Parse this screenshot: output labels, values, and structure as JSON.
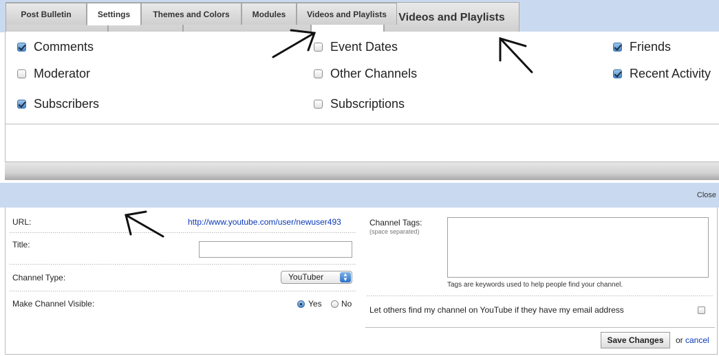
{
  "top_panel": {
    "tabs": [
      "Post Bulletin",
      "Settings",
      "Themes and Colors",
      "Modules",
      "Videos and Playlists"
    ],
    "active_tab": "Modules",
    "modules": [
      {
        "label": "Comments",
        "checked": true
      },
      {
        "label": "Moderator",
        "checked": false
      },
      {
        "label": "Subscribers",
        "checked": true
      },
      {
        "label": "Event Dates",
        "checked": false
      },
      {
        "label": "Other Channels",
        "checked": false
      },
      {
        "label": "Subscriptions",
        "checked": false
      },
      {
        "label": "Friends",
        "checked": true
      },
      {
        "label": "Recent Activity",
        "checked": true
      }
    ]
  },
  "bottom_panel": {
    "tabs": [
      "Post Bulletin",
      "Settings",
      "Themes and Colors",
      "Modules",
      "Videos and Playlists"
    ],
    "active_tab": "Settings",
    "close_label": "Close",
    "url_label": "URL:",
    "url_value": "http://www.youtube.com/user/newuser493",
    "title_label": "Title:",
    "title_value": "",
    "channel_type_label": "Channel Type:",
    "channel_type_value": "YouTuber",
    "visible_label": "Make Channel Visible:",
    "yes_label": "Yes",
    "no_label": "No",
    "visible_selected": "Yes",
    "tags_label": "Channel Tags:",
    "tags_hint": "(space separated)",
    "tags_value": "",
    "tags_help": "Tags are keywords used to help people find your channel.",
    "email_find_label": "Let others find my channel on YouTube if they have my email address",
    "email_find_checked": false,
    "save_label": "Save Changes",
    "or_label": "or",
    "cancel_label": "cancel"
  },
  "colors": {
    "tabbar_bg": "#c9daf0",
    "link": "#0b39b6",
    "checkbox_on": "#4b87c4"
  }
}
